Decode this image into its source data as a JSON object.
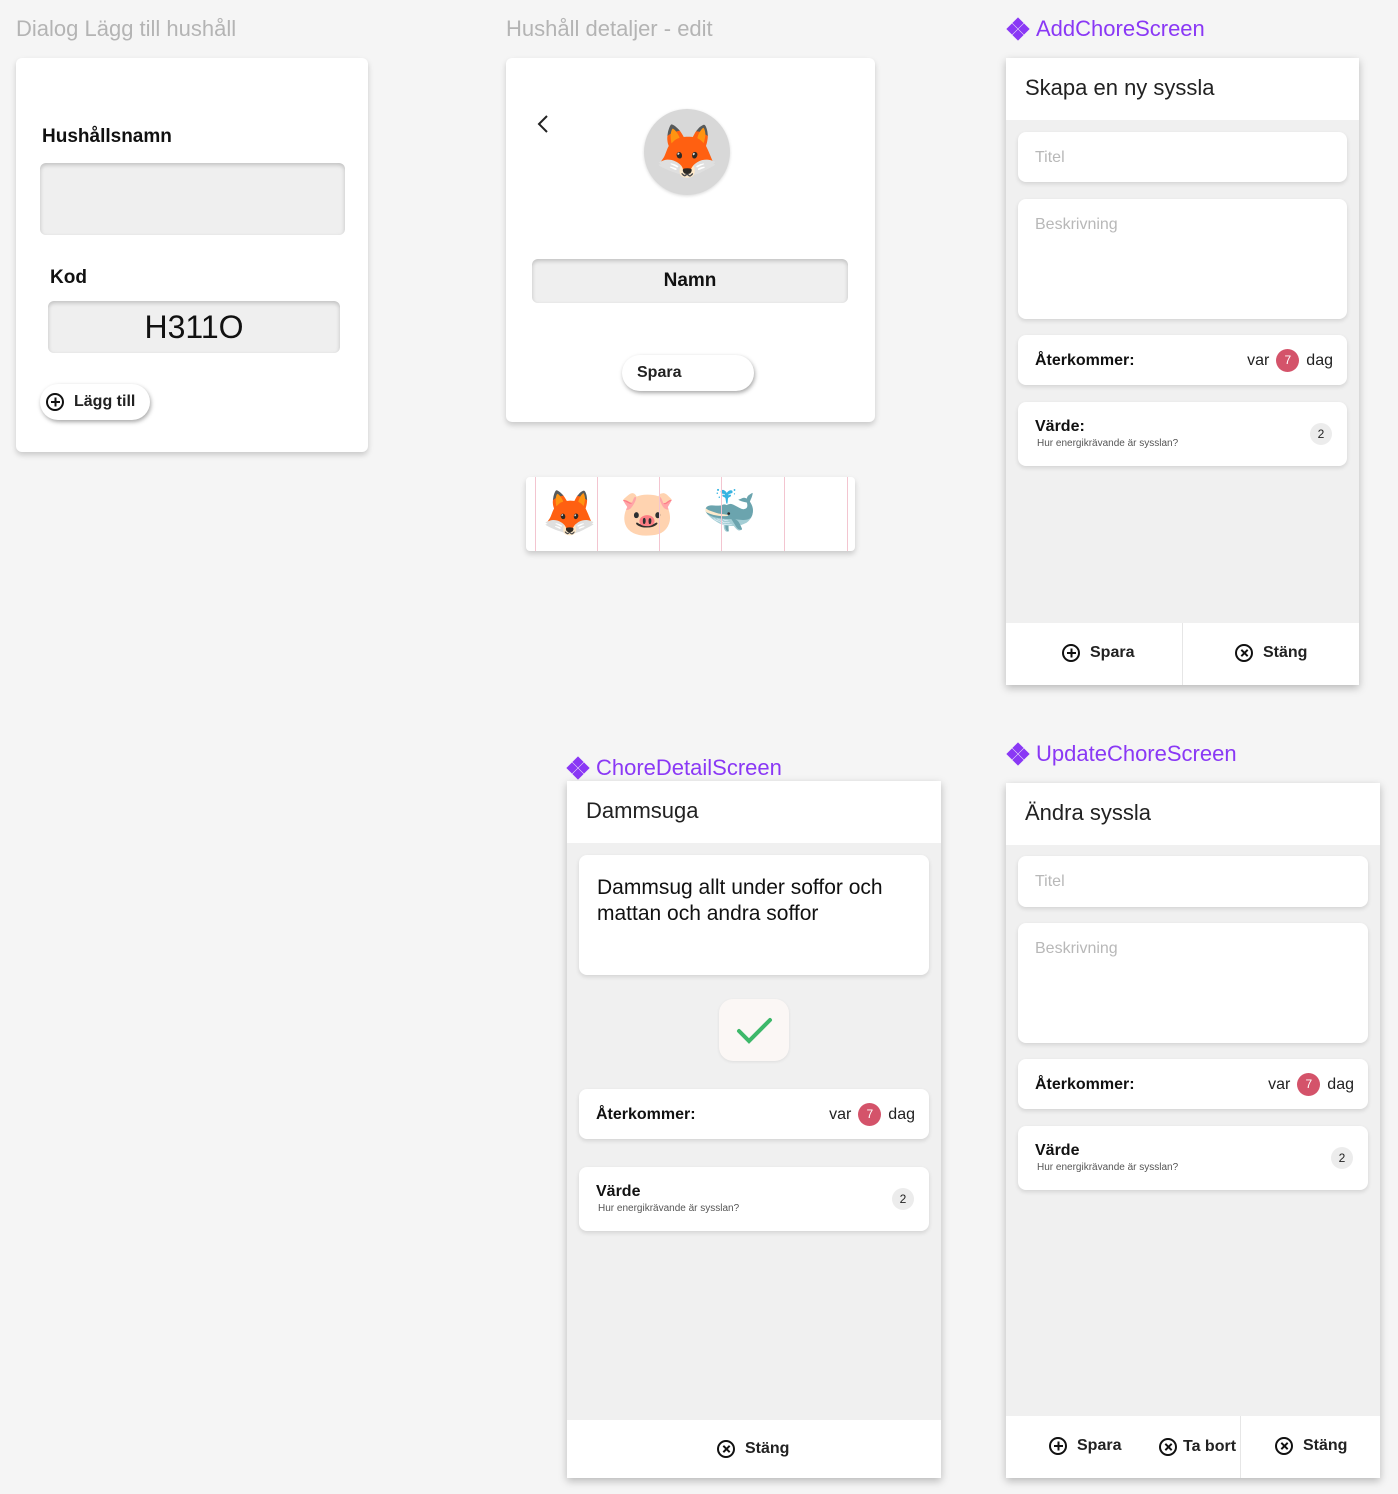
{
  "frames": {
    "dialog_add": {
      "title": "Dialog Lägg till hushåll",
      "name_label": "Hushållsnamn",
      "code_label": "Kod",
      "code_value": "H311O",
      "add_button": "Lägg till"
    },
    "household_edit": {
      "title": "Hushåll detaljer - edit",
      "name_field": "Namn",
      "save_button": "Spara",
      "avatar_icon": "fox-emoji",
      "avatars": [
        "🦊",
        "🐷",
        "🐳"
      ]
    },
    "add_chore": {
      "component": "AddChoreScreen",
      "header": "Skapa en ny syssla",
      "title_placeholder": "Titel",
      "description_placeholder": "Beskrivning",
      "recurring_label": "Återkommer:",
      "recurring_prefix": "var",
      "recurring_value": "7",
      "recurring_suffix": "dag",
      "value_label": "Värde:",
      "value_hint": "Hur energikrävande är sysslan?",
      "value_badge": "2",
      "save_button": "Spara",
      "close_button": "Stäng"
    },
    "chore_detail": {
      "component": "ChoreDetailScreen",
      "header": "Dammsuga",
      "description": "Dammsug allt under soffor och mattan och andra soffor",
      "recurring_label": "Återkommer:",
      "recurring_prefix": "var",
      "recurring_value": "7",
      "recurring_suffix": "dag",
      "value_label": "Värde",
      "value_hint": "Hur energikrävande är sysslan?",
      "value_badge": "2",
      "close_button": "Stäng"
    },
    "update_chore": {
      "component": "UpdateChoreScreen",
      "header": "Ändra syssla",
      "title_placeholder": "Titel",
      "description_placeholder": "Beskrivning",
      "recurring_label": "Återkommer:",
      "recurring_prefix": "var",
      "recurring_value": "7",
      "recurring_suffix": "dag",
      "value_label": "Värde",
      "value_hint": "Hur energikrävande är sysslan?",
      "value_badge": "2",
      "save_button": "Spara",
      "delete_button": "Ta bort",
      "close_button": "Stäng"
    }
  },
  "colors": {
    "background": "#f5f5f5",
    "component_accent": "#8a38f5",
    "badge_red": "#d4536a",
    "check_green": "#3db86a"
  }
}
